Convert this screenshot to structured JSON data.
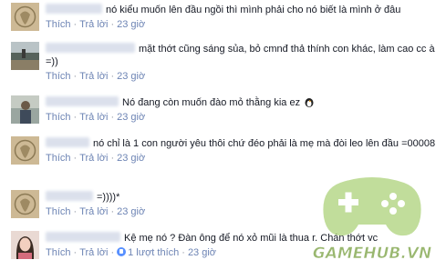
{
  "comments": [
    {
      "text": "nó kiểu muốn lên đầu ngồi thì mình phải cho nó biết là mình ở đâu",
      "like": "Thích",
      "reply": "Trả lời",
      "time": "23 giờ",
      "avatar": "sepia-emblem"
    },
    {
      "text": "mặt thớt cũng sáng sủa, bỏ cmnđ thả thính con khác, làm cao cc à =))",
      "like": "Thích",
      "reply": "Trả lời",
      "time": "23 giờ",
      "avatar": "field-photo"
    },
    {
      "text": "Nó đang còn muốn đào mỏ thằng kia ez",
      "like": "Thích",
      "reply": "Trả lời",
      "time": "23 giờ",
      "avatar": "person-photo"
    },
    {
      "text": "nó chỉ là 1 con người yêu thôi chứ đéo phải là mẹ mà đòi leo lên đầu =00008",
      "like": "Thích",
      "reply": "Trả lời",
      "time": "23 giờ",
      "avatar": "sepia-emblem"
    },
    {
      "text": "=))))*",
      "like": "Thích",
      "reply": "Trả lời",
      "time": "23 giờ",
      "avatar": "sepia-emblem"
    },
    {
      "text": "Kệ mẹ nó ? Đàn ông để nó xỏ mũi là thua r. Chán thớt vc",
      "like": "Thích",
      "reply": "Trả lời",
      "likes": "1 lượt thích",
      "time": "23 giờ",
      "avatar": "girl-photo"
    }
  ],
  "watermark": {
    "text": "GAMEHUB.VN"
  }
}
